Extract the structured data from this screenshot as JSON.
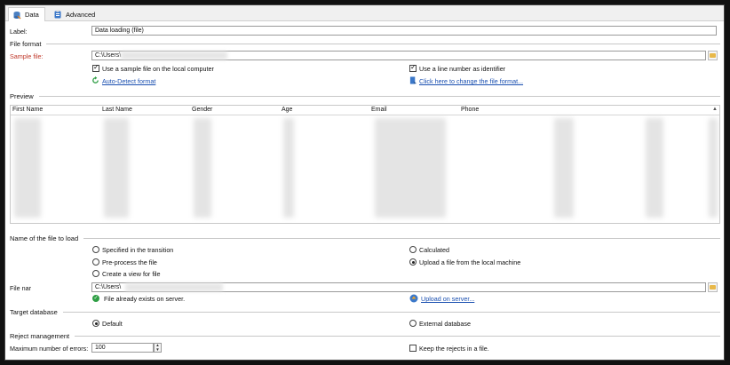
{
  "tabs": [
    {
      "label": "Data",
      "icon": "database-icon"
    },
    {
      "label": "Advanced",
      "icon": "clipboard-icon"
    }
  ],
  "label_field": {
    "label": "Label:",
    "value": "Data loading (file)"
  },
  "file_format": {
    "section_title": "File format",
    "sample_file_label": "Sample file:",
    "sample_file_value": "C:\\Users\\",
    "use_sample_local": "Use a sample file on the local computer",
    "use_line_number": "Use a line number as identifier",
    "auto_detect": "Auto-Detect format",
    "change_format": "Click here to change the file format..."
  },
  "preview": {
    "section_title": "Preview",
    "columns": [
      "First Name",
      "Last Name",
      "Gender",
      "Age",
      "Email",
      "Phone"
    ]
  },
  "file_to_load": {
    "section_title": "Name of the file to load",
    "options": {
      "specified": "Specified in the transition",
      "calculated": "Calculated",
      "preprocess": "Pre-process the file",
      "upload": "Upload a file from the local machine",
      "create_view": "Create a view for file"
    },
    "file_name_label": "File nar",
    "file_name_value": "C:\\Users\\",
    "status": "File already exists on server.",
    "upload_link": "Upload on server..."
  },
  "target_db": {
    "section_title": "Target database",
    "default": "Default",
    "external": "External database"
  },
  "reject": {
    "section_title": "Reject management",
    "max_errors_label": "Maximum number of errors:",
    "max_errors_value": "100",
    "keep_rejects": "Keep the rejects in a file."
  }
}
